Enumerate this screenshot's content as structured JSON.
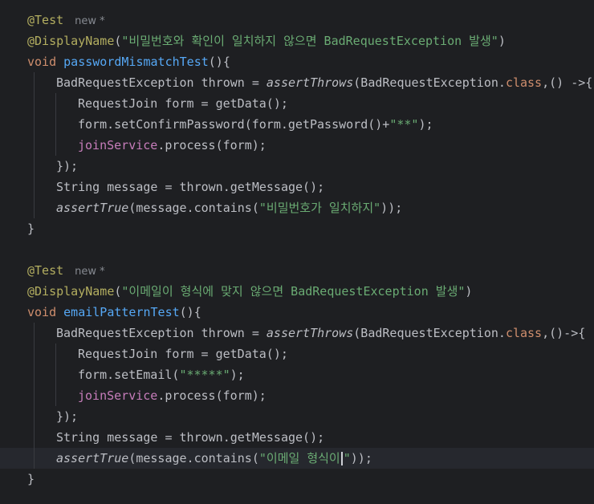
{
  "theme": {
    "background": "#1e1f22",
    "current_line": "#26282e",
    "text": "#bcbec4",
    "keyword": "#cf8e6d",
    "annotation": "#b3ae60",
    "method_decl": "#56a8f5",
    "string": "#6aab73",
    "field": "#c77dbb",
    "hint": "#868a91"
  },
  "editor": {
    "caret_line": 22,
    "lines": [
      {
        "indent": 0,
        "tokens": [
          {
            "t": "@Test",
            "c": "ann"
          },
          {
            "t": "new *",
            "c": "hint"
          }
        ]
      },
      {
        "indent": 0,
        "tokens": [
          {
            "t": "@DisplayName",
            "c": "ann"
          },
          {
            "t": "(",
            "c": ""
          },
          {
            "t": "\"비밀번호와 확인이 일치하지 않으면 BadRequestException 발생\"",
            "c": "str"
          },
          {
            "t": ")",
            "c": ""
          }
        ]
      },
      {
        "indent": 0,
        "tokens": [
          {
            "t": "void",
            "c": "kw"
          },
          {
            "t": " ",
            "c": ""
          },
          {
            "t": "passwordMismatchTest",
            "c": "fn"
          },
          {
            "t": "(){",
            "c": ""
          }
        ]
      },
      {
        "indent": 1,
        "tokens": [
          {
            "t": "BadRequestException thrown = ",
            "c": ""
          },
          {
            "t": "assertThrows",
            "c": "it"
          },
          {
            "t": "(BadRequestException.",
            "c": ""
          },
          {
            "t": "class",
            "c": "kw"
          },
          {
            "t": ",() ->{",
            "c": ""
          }
        ]
      },
      {
        "indent": 2,
        "tokens": [
          {
            "t": "RequestJoin form = getData();",
            "c": ""
          }
        ]
      },
      {
        "indent": 2,
        "tokens": [
          {
            "t": "form.setConfirmPassword(form.getPassword()+",
            "c": ""
          },
          {
            "t": "\"**\"",
            "c": "str"
          },
          {
            "t": ");",
            "c": ""
          }
        ]
      },
      {
        "indent": 2,
        "tokens": [
          {
            "t": "joinService",
            "c": "fld"
          },
          {
            "t": ".process(form);",
            "c": ""
          }
        ]
      },
      {
        "indent": 1,
        "tokens": [
          {
            "t": "});",
            "c": ""
          }
        ]
      },
      {
        "indent": 1,
        "tokens": [
          {
            "t": "String message = thrown.getMessage();",
            "c": ""
          }
        ]
      },
      {
        "indent": 1,
        "tokens": [
          {
            "t": "assertTrue",
            "c": "it"
          },
          {
            "t": "(message.contains(",
            "c": ""
          },
          {
            "t": "\"비밀번호가 일치하지\"",
            "c": "str"
          },
          {
            "t": "));",
            "c": ""
          }
        ]
      },
      {
        "indent": 0,
        "tokens": [
          {
            "t": "}",
            "c": ""
          }
        ]
      },
      {
        "indent": 0,
        "tokens": []
      },
      {
        "indent": 0,
        "tokens": [
          {
            "t": "@Test",
            "c": "ann"
          },
          {
            "t": "new *",
            "c": "hint"
          }
        ]
      },
      {
        "indent": 0,
        "tokens": [
          {
            "t": "@DisplayName",
            "c": "ann"
          },
          {
            "t": "(",
            "c": ""
          },
          {
            "t": "\"이메일이 형식에 맞지 않으면 BadRequestException 발생\"",
            "c": "str"
          },
          {
            "t": ")",
            "c": ""
          }
        ]
      },
      {
        "indent": 0,
        "tokens": [
          {
            "t": "void",
            "c": "kw"
          },
          {
            "t": " ",
            "c": ""
          },
          {
            "t": "emailPatternTest",
            "c": "fn"
          },
          {
            "t": "(){",
            "c": ""
          }
        ]
      },
      {
        "indent": 1,
        "tokens": [
          {
            "t": "BadRequestException thrown = ",
            "c": ""
          },
          {
            "t": "assertThrows",
            "c": "it"
          },
          {
            "t": "(BadRequestException.",
            "c": ""
          },
          {
            "t": "class",
            "c": "kw"
          },
          {
            "t": ",()->{",
            "c": ""
          }
        ]
      },
      {
        "indent": 2,
        "tokens": [
          {
            "t": "RequestJoin form = getData();",
            "c": ""
          }
        ]
      },
      {
        "indent": 2,
        "tokens": [
          {
            "t": "form.setEmail(",
            "c": ""
          },
          {
            "t": "\"*****\"",
            "c": "str"
          },
          {
            "t": ");",
            "c": ""
          }
        ]
      },
      {
        "indent": 2,
        "tokens": [
          {
            "t": "joinService",
            "c": "fld"
          },
          {
            "t": ".process(form);",
            "c": ""
          }
        ]
      },
      {
        "indent": 1,
        "tokens": [
          {
            "t": "});",
            "c": ""
          }
        ]
      },
      {
        "indent": 1,
        "tokens": [
          {
            "t": "String message = thrown.getMessage();",
            "c": ""
          }
        ]
      },
      {
        "indent": 1,
        "tokens": [
          {
            "t": "assertTrue",
            "c": "it"
          },
          {
            "t": "(message.contains(",
            "c": ""
          },
          {
            "t": "\"이메일 형식이",
            "c": "str"
          },
          {
            "t": "CARET",
            "c": "caret"
          },
          {
            "t": "\"",
            "c": "str"
          },
          {
            "t": "));",
            "c": ""
          }
        ]
      },
      {
        "indent": 0,
        "tokens": [
          {
            "t": "}",
            "c": ""
          }
        ]
      }
    ]
  }
}
